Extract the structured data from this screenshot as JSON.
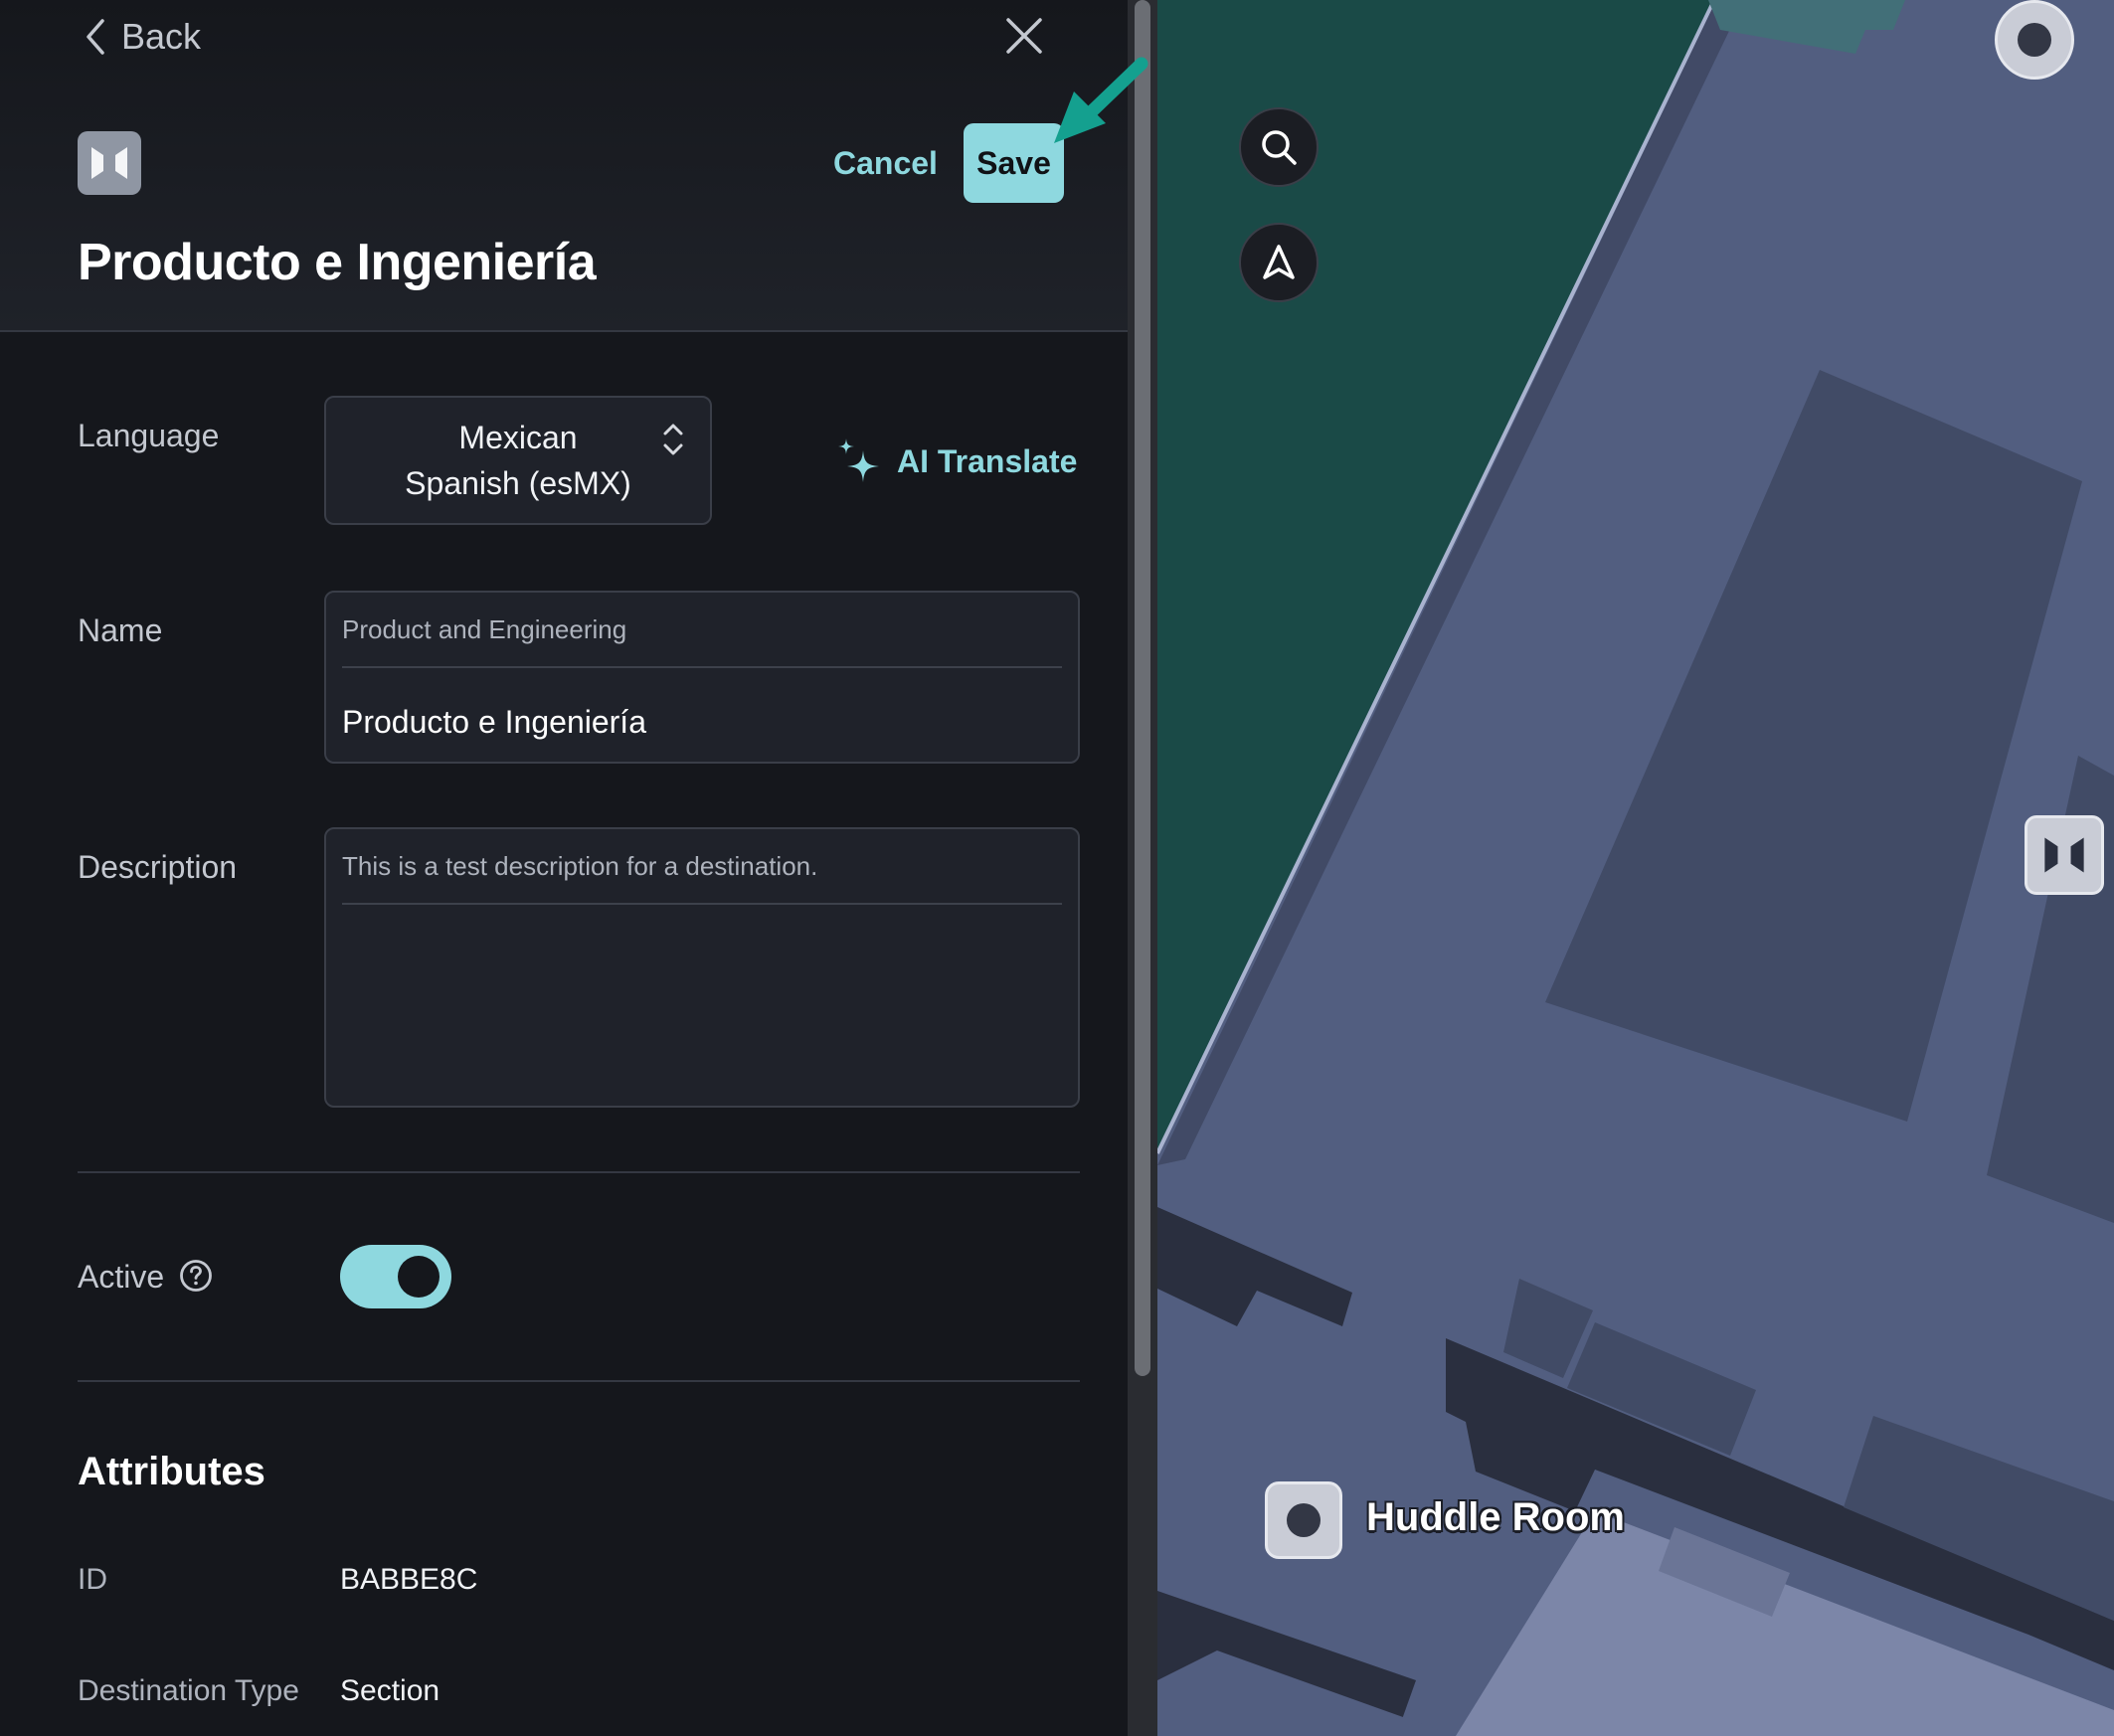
{
  "header": {
    "back_label": "Back",
    "cancel_label": "Cancel",
    "save_label": "Save",
    "title": "Producto e Ingeniería"
  },
  "form": {
    "language": {
      "label": "Language",
      "value": "Mexican Spanish (esMX)"
    },
    "ai_translate_label": "AI Translate",
    "name": {
      "label": "Name",
      "reference": "Product and Engineering",
      "value": "Producto e Ingeniería"
    },
    "description": {
      "label": "Description",
      "reference": "This is a test description for a destination.",
      "value": ""
    },
    "active": {
      "label": "Active",
      "enabled": true
    }
  },
  "attributes": {
    "title": "Attributes",
    "items": [
      {
        "key": "ID",
        "value": "BABBE8C"
      },
      {
        "key": "Destination Type",
        "value": "Section"
      }
    ]
  },
  "map": {
    "room_label": "Huddle Room"
  },
  "icons": {
    "back": "chevron-left-icon",
    "close": "close-icon",
    "logo": "mappedin-logo-icon",
    "select": "chevron-up-down-icon",
    "ai": "sparkle-icon",
    "help": "question-circle-icon",
    "search": "search-icon",
    "navigate": "navigation-arrow-icon"
  },
  "colors": {
    "accent": "#8ed8df",
    "annotation_arrow": "#14a08f",
    "panel_bg": "#15171c",
    "map_floor": "#525e80",
    "map_outside": "#1a4a47"
  }
}
